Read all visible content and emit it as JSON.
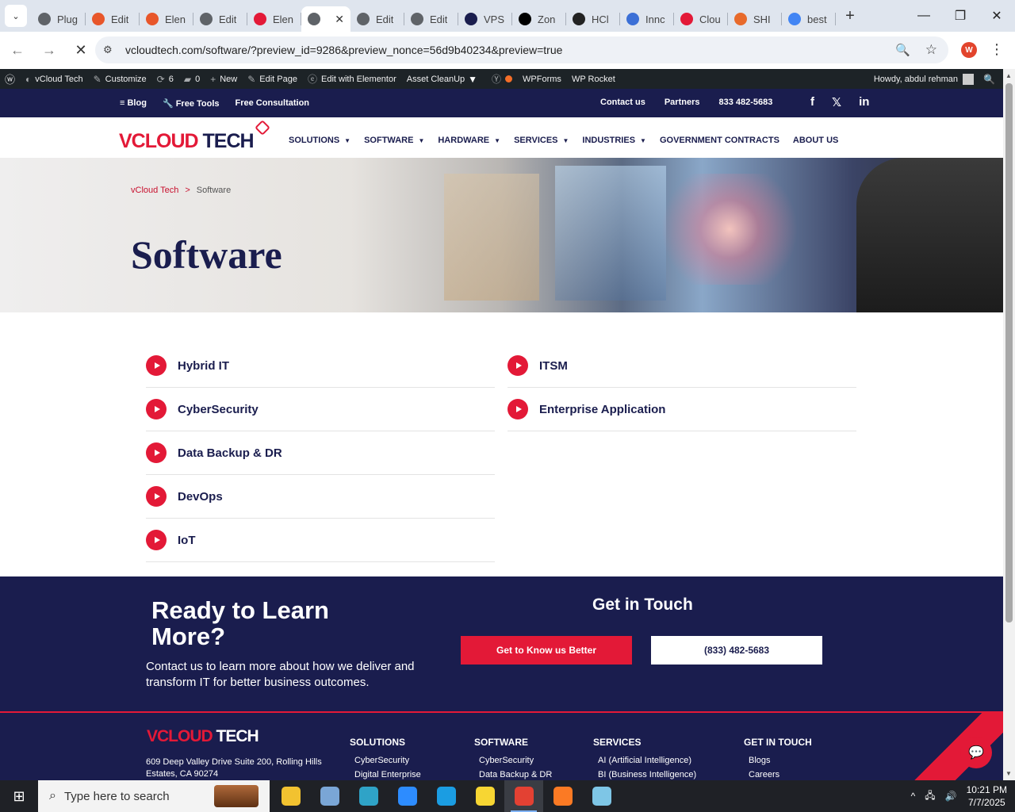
{
  "browser": {
    "tabs": [
      {
        "label": "Plug",
        "icon_color": "#5f6368",
        "icon": "globe-icon"
      },
      {
        "label": "Edit",
        "icon_color": "#e8562a",
        "icon": "xampp-icon"
      },
      {
        "label": "Elen",
        "icon_color": "#e8562a",
        "icon": "xampp-icon"
      },
      {
        "label": "Edit",
        "icon_color": "#5f6368",
        "icon": "globe-icon"
      },
      {
        "label": "Elen",
        "icon_color": "#e31937",
        "icon": "vcloud-icon"
      },
      {
        "label": "",
        "icon_color": "#5f6368",
        "icon": "loading-icon",
        "active": true
      },
      {
        "label": "Edit",
        "icon_color": "#5f6368",
        "icon": "globe-icon"
      },
      {
        "label": "Edit",
        "icon_color": "#5f6368",
        "icon": "globe-icon"
      },
      {
        "label": "VPS",
        "icon_color": "#1a1d4e",
        "icon": "v-icon"
      },
      {
        "label": "Zon",
        "icon_color": "#000000",
        "icon": "z-icon"
      },
      {
        "label": "HCl",
        "icon_color": "#222222",
        "icon": "hci-icon"
      },
      {
        "label": "Innc",
        "icon_color": "#3b6fd6",
        "icon": "inno-icon"
      },
      {
        "label": "Clou",
        "icon_color": "#e31937",
        "icon": "cloud-icon"
      },
      {
        "label": "SHI",
        "icon_color": "#e86a2b",
        "icon": "shi-icon"
      },
      {
        "label": "best",
        "icon_color": "#4285f4",
        "icon": "google-icon"
      }
    ],
    "new_tab": "+",
    "url": "vcloudtech.com/software/?preview_id=9286&preview_nonce=56d9b40234&preview=true",
    "profile_initial": "W"
  },
  "wp_admin_bar": {
    "items": [
      "vCloud Tech",
      "Customize",
      "6",
      "0",
      "New",
      "Edit Page",
      "Edit with Elementor",
      "Asset CleanUp",
      "WPForms",
      "WP Rocket"
    ],
    "howdy": "Howdy, abdul rehman"
  },
  "topbar": {
    "left": [
      "Blog",
      "Free Tools",
      "Free Consultation"
    ],
    "right": [
      "Contact us",
      "Partners",
      "833 482-5683"
    ],
    "social": [
      "f",
      "𝕏",
      "in"
    ]
  },
  "nav": {
    "logo_a": "VCLOUD",
    "logo_b": " TECH",
    "items": [
      {
        "label": "SOLUTIONS",
        "caret": "▼"
      },
      {
        "label": "SOFTWARE",
        "caret": "▼"
      },
      {
        "label": "HARDWARE",
        "caret": "▼"
      },
      {
        "label": "SERVICES",
        "caret": "▼"
      },
      {
        "label": "INDUSTRIES",
        "caret": "▼"
      },
      {
        "label": "GOVERNMENT CONTRACTS",
        "caret": ""
      },
      {
        "label": "ABOUT US",
        "caret": ""
      }
    ]
  },
  "hero": {
    "breadcrumb_home": "vCloud Tech",
    "breadcrumb_sep": ">",
    "breadcrumb_current": "Software",
    "title": "Software"
  },
  "software_list": {
    "left": [
      "Hybrid IT",
      "CyberSecurity",
      "Data Backup & DR",
      "DevOps",
      "IoT"
    ],
    "right": [
      "ITSM",
      "Enterprise Application"
    ]
  },
  "cta": {
    "heading": "Ready to Learn More?",
    "text": "Contact us to learn more about how we deliver and transform IT for better business outcomes.",
    "get_in_touch": "Get in Touch",
    "btn_primary": "Get to Know us Better",
    "btn_phone": "(833) 482-5683"
  },
  "footer": {
    "logo_a": "VCLOUD",
    "logo_b": " TECH",
    "address": "609 Deep Valley Drive Suite 200, Rolling Hills Estates, CA 90274",
    "cols": [
      {
        "heading": "SOLUTIONS",
        "items": [
          "CyberSecurity",
          "Digital Enterprise"
        ]
      },
      {
        "heading": "SOFTWARE",
        "items": [
          "CyberSecurity",
          "Data Backup & DR"
        ]
      },
      {
        "heading": "SERVICES",
        "items": [
          "AI (Artificial Intelligence)",
          "BI (Business Intelligence)"
        ]
      },
      {
        "heading": "GET IN TOUCH",
        "items": [
          "Blogs",
          "Careers"
        ]
      }
    ]
  },
  "taskbar": {
    "search_placeholder": "Type here to search",
    "time": "10:21 PM",
    "date": "7/7/2025",
    "apps": [
      {
        "name": "file-explorer-icon",
        "color": "#f2c230"
      },
      {
        "name": "paint-icon",
        "color": "#7aa6d6"
      },
      {
        "name": "app-diamond-icon",
        "color": "#2fa3c7"
      },
      {
        "name": "zoom-icon",
        "color": "#2d8cff"
      },
      {
        "name": "edge-icon",
        "color": "#1b9de2"
      },
      {
        "name": "sticky-notes-icon",
        "color": "#f7d633"
      },
      {
        "name": "chrome-icon",
        "color": "#e34133",
        "active": true
      },
      {
        "name": "xampp-icon",
        "color": "#fb7a24"
      },
      {
        "name": "notepad-icon",
        "color": "#7ec6e6"
      }
    ]
  }
}
